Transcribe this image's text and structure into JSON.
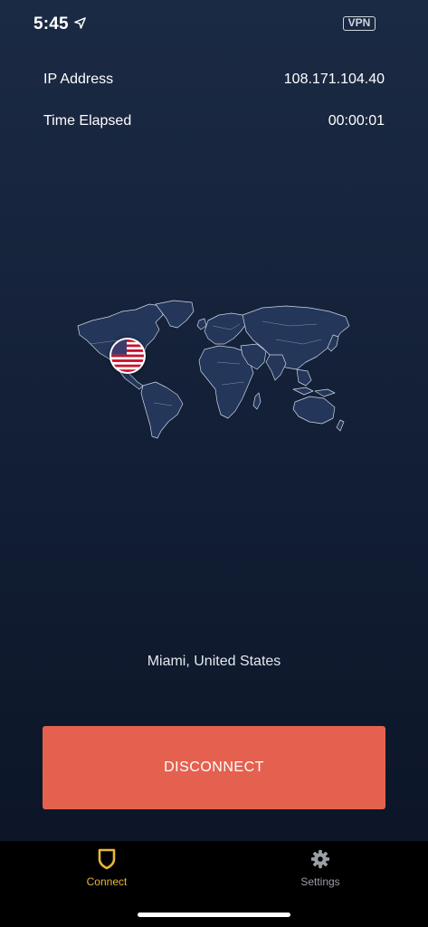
{
  "status_bar": {
    "time": "5:45",
    "location_icon": "location-arrow-icon",
    "vpn_badge": "VPN"
  },
  "connection_info": {
    "ip_label": "IP Address",
    "ip_value": "108.171.104.40",
    "time_label": "Time Elapsed",
    "time_value": "00:00:01"
  },
  "map": {
    "icon": "world-map",
    "flag_icon": "us-flag-icon"
  },
  "location": {
    "label": "Miami, United States"
  },
  "disconnect_button": {
    "label": "DISCONNECT",
    "color": "#e5614f"
  },
  "tab_bar": {
    "tabs": [
      {
        "label": "Connect",
        "icon": "shield-icon",
        "active": true,
        "color": "#e8b838"
      },
      {
        "label": "Settings",
        "icon": "gear-icon",
        "active": false,
        "color": "#9a9ea6"
      }
    ]
  }
}
